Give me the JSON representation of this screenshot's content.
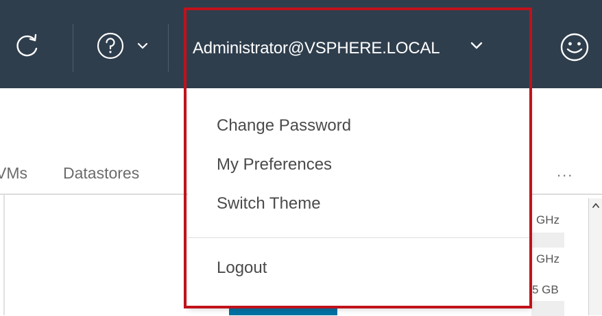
{
  "header": {
    "background_color": "#2f3e4d",
    "icons": {
      "refresh": "refresh-icon",
      "help": "help-circle-icon",
      "help_caret": "chevron-down-icon",
      "user_caret": "chevron-down-icon",
      "user_avatar": "smiley-face-icon"
    },
    "username": "Administrator@VSPHERE.LOCAL"
  },
  "tabs": {
    "partial_vms": "VMs",
    "datastores": "Datastores",
    "more": "..."
  },
  "resources": {
    "row1": "GHz",
    "row2": "GHz",
    "row3": "5 GB"
  },
  "user_menu": {
    "items": [
      {
        "label": "Change Password"
      },
      {
        "label": "My Preferences"
      },
      {
        "label": "Switch Theme"
      }
    ],
    "logout_label": "Logout"
  },
  "highlight_color": "#c0121b"
}
